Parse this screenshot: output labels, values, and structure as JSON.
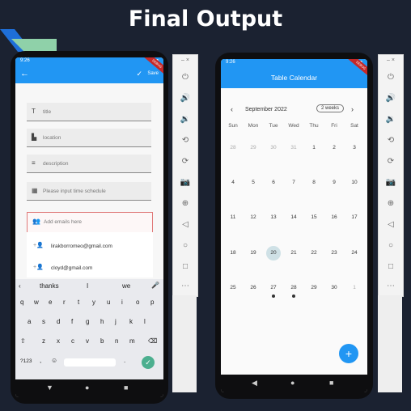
{
  "header": {
    "title": "Final Output"
  },
  "left_phone": {
    "status_time": "9:26",
    "save_label": "Save",
    "debug_banner": "DEBUG",
    "fields": {
      "title_placeholder": "title",
      "location_placeholder": "location",
      "description_placeholder": "description",
      "schedule_placeholder": "Please input time schedule",
      "emails_placeholder": "Add emails here"
    },
    "suggestions": [
      "lirakborromeo@gmail.com",
      "cloyd@gmail.com"
    ],
    "keyboard": {
      "predictions": [
        "thanks",
        "I",
        "we"
      ],
      "row1": [
        "q",
        "w",
        "e",
        "r",
        "t",
        "y",
        "u",
        "i",
        "o",
        "p"
      ],
      "row2": [
        "a",
        "s",
        "d",
        "f",
        "g",
        "h",
        "j",
        "k",
        "l"
      ],
      "row3": [
        "z",
        "x",
        "c",
        "v",
        "b",
        "n",
        "m"
      ],
      "symbols_key": "?123",
      "comma_key": ",",
      "period_key": "."
    }
  },
  "right_phone": {
    "status_time": "9:26",
    "app_title": "Table Calendar",
    "debug_banner": "DEBUG",
    "month_label": "September 2022",
    "format_button": "2 weeks",
    "weekdays": [
      "Sun",
      "Mon",
      "Tue",
      "Wed",
      "Thu",
      "Fri",
      "Sat"
    ],
    "weeks": [
      [
        "28",
        "29",
        "30",
        "31",
        "1",
        "2",
        "3"
      ],
      [
        "4",
        "5",
        "6",
        "7",
        "8",
        "9",
        "10"
      ],
      [
        "11",
        "12",
        "13",
        "14",
        "15",
        "16",
        "17"
      ],
      [
        "18",
        "19",
        "20",
        "21",
        "22",
        "23",
        "24"
      ],
      [
        "25",
        "26",
        "27",
        "28",
        "29",
        "30",
        "1"
      ]
    ],
    "fab_label": "+"
  },
  "colors": {
    "primary": "#2196f3",
    "background": "#1b2231",
    "accent_green": "#8fd1a9",
    "accent_blue": "#1e6fd9"
  }
}
